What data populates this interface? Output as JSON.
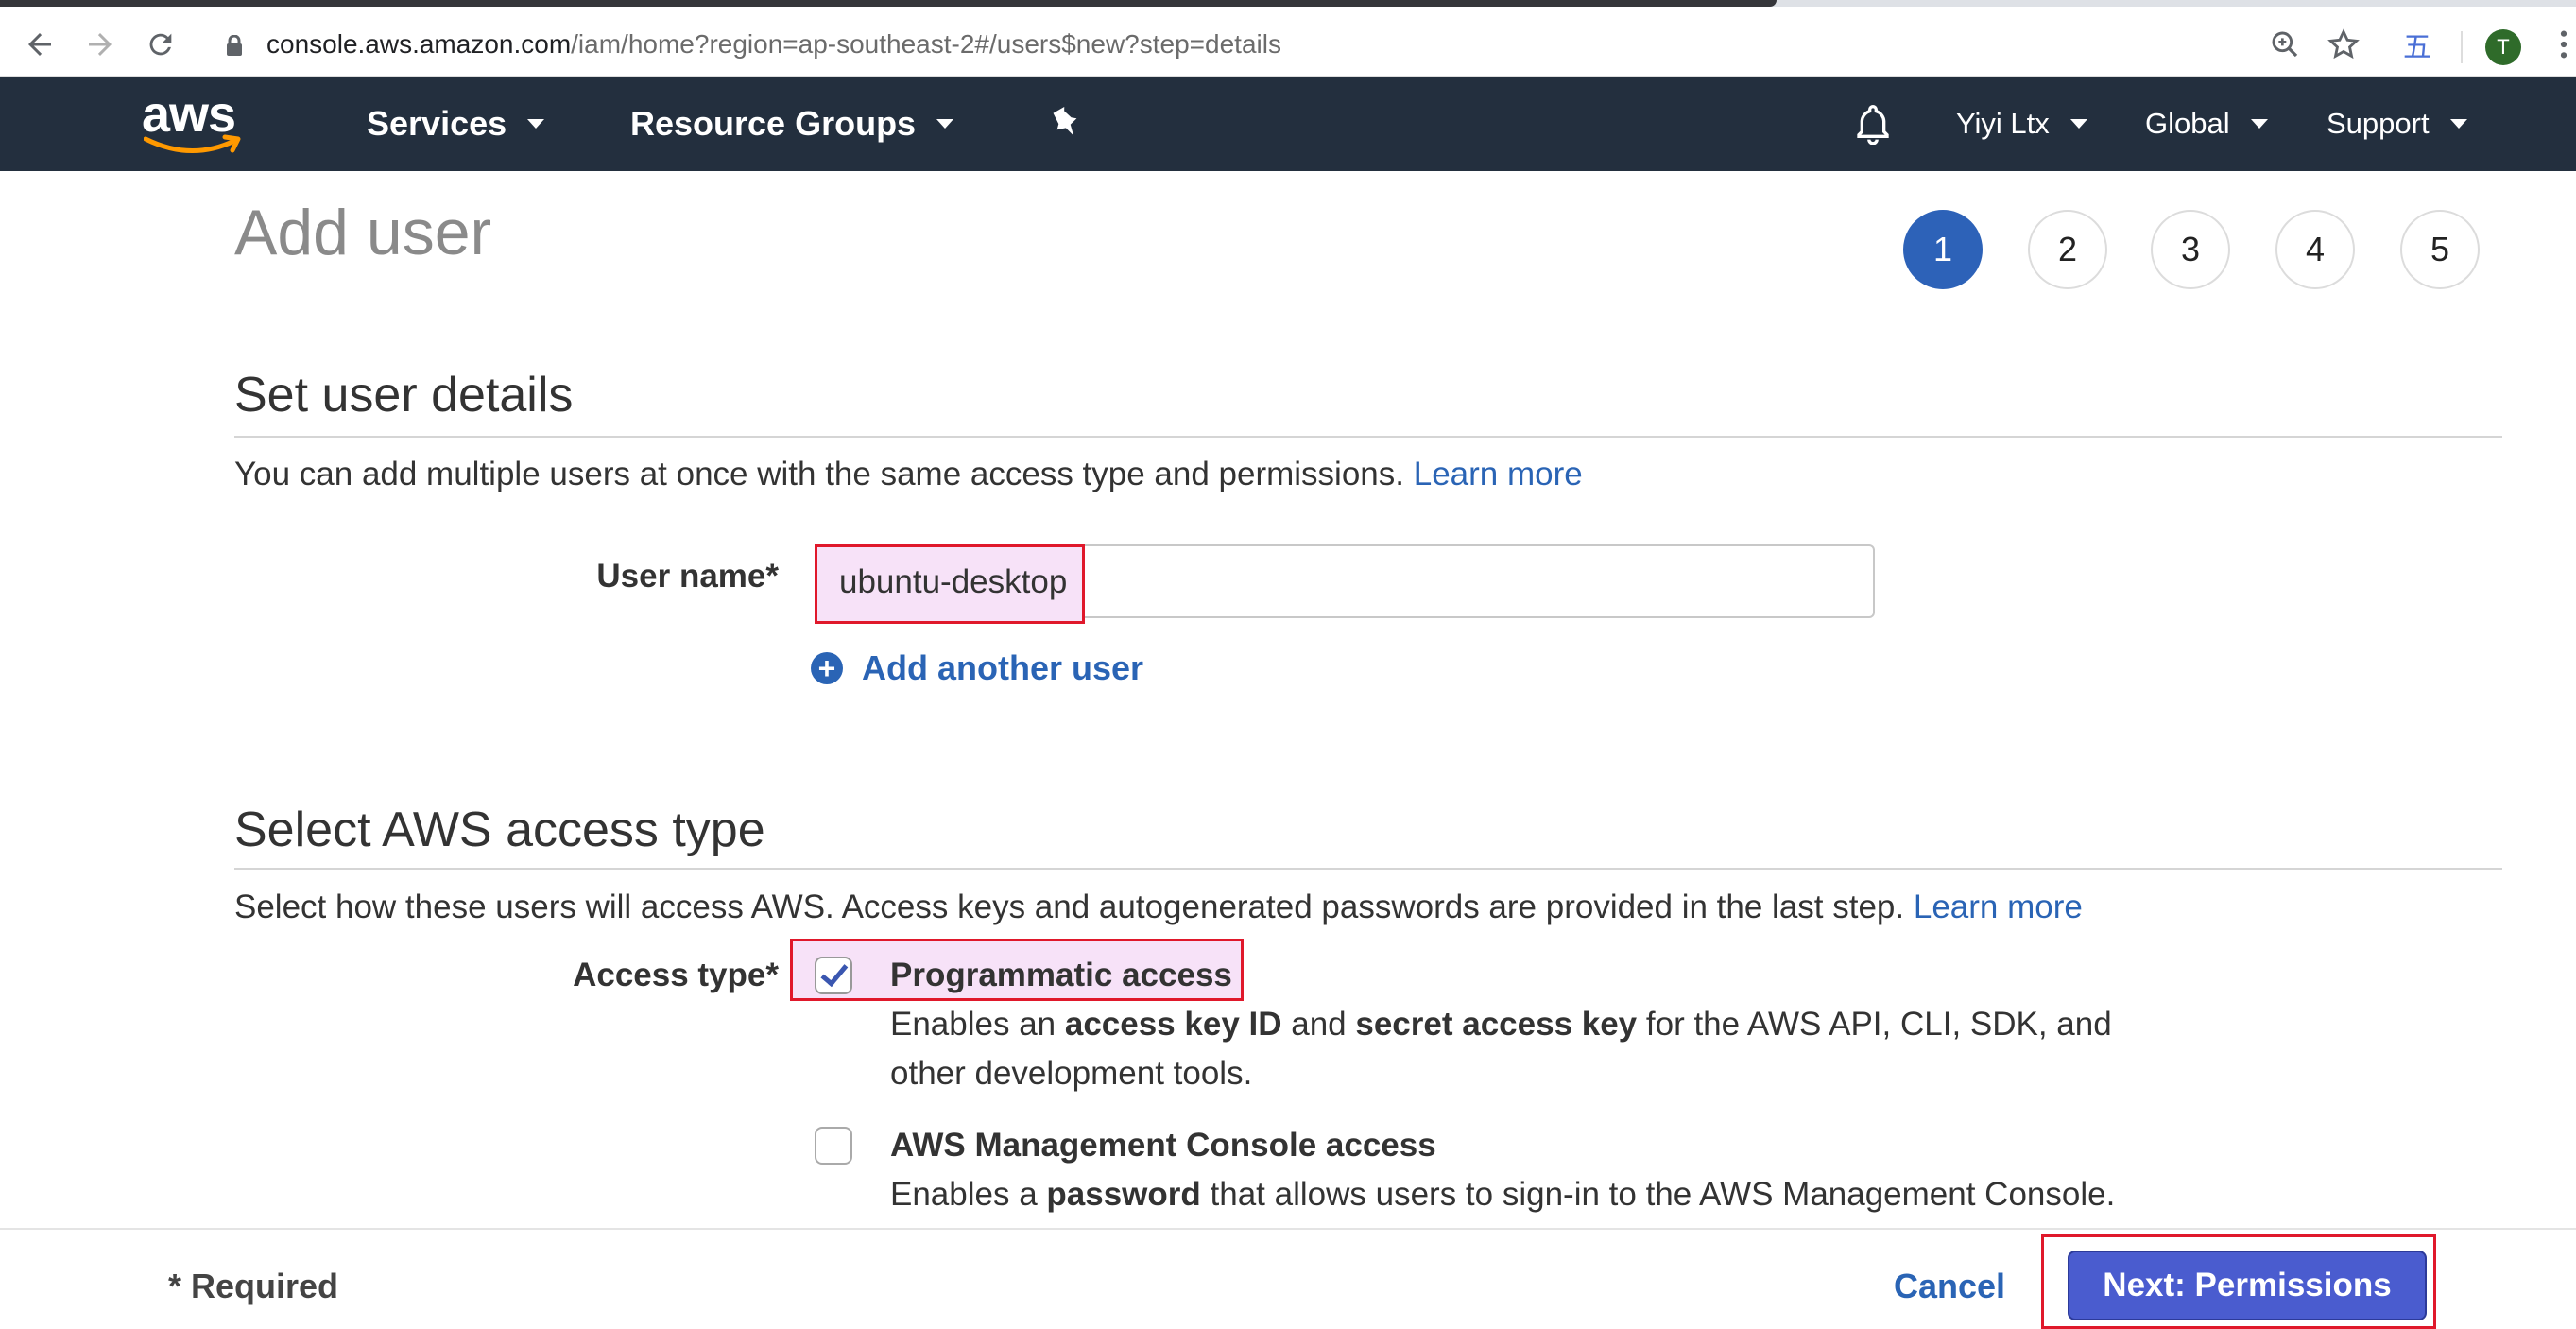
{
  "browser": {
    "url_host": "console.aws.amazon.com",
    "url_path": "/iam/home?region=ap-southeast-2#/users$new?step=details",
    "ime_glyph": "五",
    "profile_initial": "T"
  },
  "nav": {
    "logo": "aws",
    "services": "Services",
    "resource_groups": "Resource Groups",
    "user": "Yiyi Ltx",
    "region": "Global",
    "support": "Support"
  },
  "page": {
    "title": "Add user",
    "steps": [
      "1",
      "2",
      "3",
      "4",
      "5"
    ],
    "active_step": "1"
  },
  "details": {
    "title": "Set user details",
    "desc": "You can add multiple users at once with the same access type and permissions.",
    "learn_more": "Learn more",
    "user_name_label": "User name*",
    "user_name_value": "ubuntu-desktop",
    "add_another": "Add another user"
  },
  "access": {
    "title": "Select AWS access type",
    "desc": "Select how these users will access AWS. Access keys and autogenerated passwords are provided in the last step.",
    "learn_more": "Learn more",
    "label": "Access type*",
    "prog_title": "Programmatic access",
    "prog_desc": {
      "a": "Enables an ",
      "b": "access key ID",
      "c": " and ",
      "d": "secret access key",
      "e": " for the AWS API, CLI, SDK, and",
      "f": "other development tools."
    },
    "console_title": "AWS Management Console access",
    "console_desc": {
      "a": "Enables a ",
      "b": "password",
      "c": " that allows users to sign-in to the AWS Management Console."
    }
  },
  "footer": {
    "required": "* Required",
    "cancel": "Cancel",
    "next": "Next: Permissions"
  },
  "colors": {
    "nav_bg": "#232f3e",
    "link": "#2a64b5",
    "active_step": "#2d62b8",
    "highlight_border": "#e0182b",
    "primary_button": "#4a5ccf"
  }
}
